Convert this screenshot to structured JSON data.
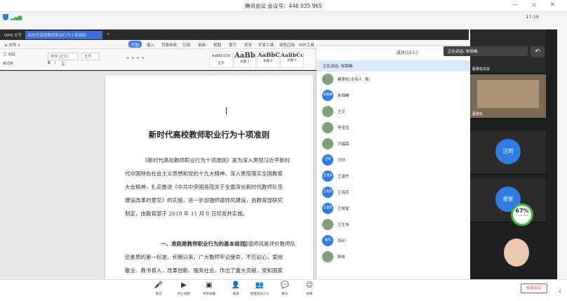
{
  "meeting": {
    "title": "腾讯会议 会议号：446 035 965",
    "time": "17:16"
  },
  "wps": {
    "tabs": [
      "WPS 文字",
      "新时代高校教师职业行为十项准则",
      "+"
    ],
    "menu_start": "开始",
    "menu": [
      "插入",
      "页面布局",
      "引用",
      "审阅",
      "视图",
      "章节",
      "安全",
      "开发工具",
      "特色应用",
      "PDF工具",
      "Acrobat"
    ],
    "font_name": "宋体 (正文)",
    "font_size": "五号",
    "styles": [
      {
        "sample": "AaBbCcDd",
        "name": "正文"
      },
      {
        "sample": "AaBb",
        "name": "标题 1"
      },
      {
        "sample": "AaBbC",
        "name": "标题 2"
      },
      {
        "sample": "AaBbCc",
        "name": "标题 3"
      }
    ]
  },
  "document": {
    "title": "新时代高校教师职业行为十项准则",
    "lines": [
      "《新时代高校教师职业行为十项准则》是为深入贯彻习近平新时",
      "代中国特色社会主义思想和党的十九大精神，深入贯彻落实全国教育",
      "大会精神，扎实推进《中共中央国务院关于全面深化新时代教师队伍",
      "建设改革的意见》的实施，进一步加强师德师风建设，由教育部研究",
      "制定，由教育部于 2018 年 11 月 8 日印发并实施。"
    ],
    "section_head": "一、准则是教师职业行为的基本规范。",
    "section_lines": [
      "师德师风是评价教师队",
      "伍素质的第一标准。长期以来，广大教师牢记使命，不忘初心，爱岗",
      "敬业、教书育人，改革创新、服务社会，作出了重大贡献，党和国家"
    ]
  },
  "panel": {
    "title": "成员(15人)",
    "speaking": "正在讲话: 朱锦峰;",
    "members": [
      {
        "avatar": "",
        "name": "蔡惠松(主持人, 我)",
        "photo": true,
        "mic_on": false,
        "cam_on": false
      },
      {
        "avatar": "朱锦峰",
        "name": "朱锦峰",
        "photo": false,
        "mic_on": true,
        "cam_on": true
      },
      {
        "avatar": "",
        "name": "王文",
        "photo": true,
        "mic_on": false,
        "cam_on": false
      },
      {
        "avatar": "",
        "name": "李宝宝",
        "photo": true,
        "mic_on": false,
        "cam_on": false
      },
      {
        "avatar": "",
        "name": "卢福荣",
        "photo": true,
        "mic_on": false,
        "cam_on": false
      },
      {
        "avatar": "汪珂",
        "name": "汪珂",
        "photo": false,
        "mic_on": false,
        "cam_on": false
      },
      {
        "avatar": "王涵东",
        "name": "王涵东",
        "photo": false,
        "mic_on": false,
        "cam_on": false
      },
      {
        "avatar": "王海芳",
        "name": "王海芳",
        "photo": false,
        "mic_on": false,
        "cam_on": false
      },
      {
        "avatar": "王俊堂",
        "name": "王俊堂",
        "photo": false,
        "mic_on": false,
        "cam_on": false
      },
      {
        "avatar": "",
        "name": "王生伟",
        "photo": true,
        "mic_on": false,
        "cam_on": false
      },
      {
        "avatar": "张纪",
        "name": "张纪",
        "photo": false,
        "mic_on": false,
        "cam_on": false
      },
      {
        "avatar": "",
        "name": "陈晓",
        "photo": true,
        "mic_on": false,
        "cam_on": false
      }
    ]
  },
  "videos": {
    "speaking_tag": "正在讲话: 朱锦峰;",
    "tiles": [
      {
        "name": "蔡惠松共享",
        "avatar": ""
      },
      {
        "name": "蔡惠松",
        "avatar": ""
      },
      {
        "name": "",
        "avatar": "汪珂"
      },
      {
        "name": "",
        "avatar": "俊堂"
      }
    ],
    "battery_pct": "67%",
    "net_speed": "↑ 36.7K/s"
  },
  "toolbar": {
    "buttons": [
      {
        "icon": "🎤",
        "label": "静音"
      },
      {
        "icon": "▶",
        "label": "停止视频"
      },
      {
        "icon": "▣",
        "label": "共享屏幕"
      },
      {
        "icon": "👤",
        "label": "邀请"
      },
      {
        "icon": "👥",
        "label": "管理成员(15)"
      },
      {
        "icon": "💬",
        "label": "聊天"
      },
      {
        "icon": "☺",
        "label": "表情"
      }
    ],
    "end_label": "结束会议"
  },
  "colors": {
    "accent": "#2f7de1",
    "active_green": "#2db45a",
    "end_red": "#e24b4b"
  }
}
